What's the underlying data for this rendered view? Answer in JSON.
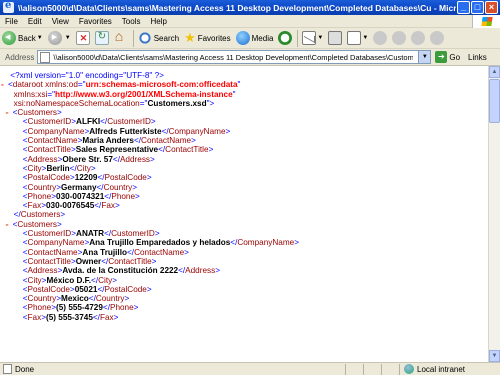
{
  "window": {
    "title": "\\\\alison5000\\d\\Data\\Clients\\sams\\Mastering Access 11 Desktop Development\\Completed Databases\\Cu - Microsoft Internet..."
  },
  "menu": [
    "File",
    "Edit",
    "View",
    "Favorites",
    "Tools",
    "Help"
  ],
  "toolbar": {
    "back": "Back",
    "search": "Search",
    "favorites": "Favorites",
    "media": "Media"
  },
  "address": {
    "label": "Address",
    "url": "\\\\alison5000\\d\\Data\\Clients\\sams\\Mastering Access 11 Desktop Development\\Completed Databases\\Customers.xml",
    "go": "Go",
    "links": "Links"
  },
  "xml": {
    "decl": "<?xml version=\"1.0\" encoding=\"UTF-8\" ?>",
    "root_open": "dataroot",
    "attr1_name": "xmlns:od",
    "attr1_value": "urn:schemas-microsoft-com:officedata",
    "attr2_name": "xmlns:xsi",
    "attr2_value": "http://www.w3.org/2001/XMLSchema-instance",
    "attr3_name": "xsi:noNamespaceSchemaLocation",
    "attr3_value": "Customers.xsd",
    "record_tag": "Customers",
    "records": [
      {
        "CustomerID": "ALFKI",
        "CompanyName": "Alfreds Futterkiste",
        "ContactName": "Maria Anders",
        "ContactTitle": "Sales Representative",
        "Address": "Obere Str. 57",
        "City": "Berlin",
        "PostalCode": "12209",
        "Country": "Germany",
        "Phone": "030-0074321",
        "Fax": "030-0076545"
      },
      {
        "CustomerID": "ANATR",
        "CompanyName": "Ana Trujillo Emparedados y helados",
        "ContactName": "Ana Trujillo",
        "ContactTitle": "Owner",
        "Address": "Avda. de la Constitución 2222",
        "City": "México D.F.",
        "PostalCode": "05021",
        "Country": "Mexico",
        "Phone": "(5) 555-4729",
        "Fax": "(5) 555-3745"
      }
    ]
  },
  "status": {
    "text": "Done",
    "zone": "Local intranet"
  }
}
